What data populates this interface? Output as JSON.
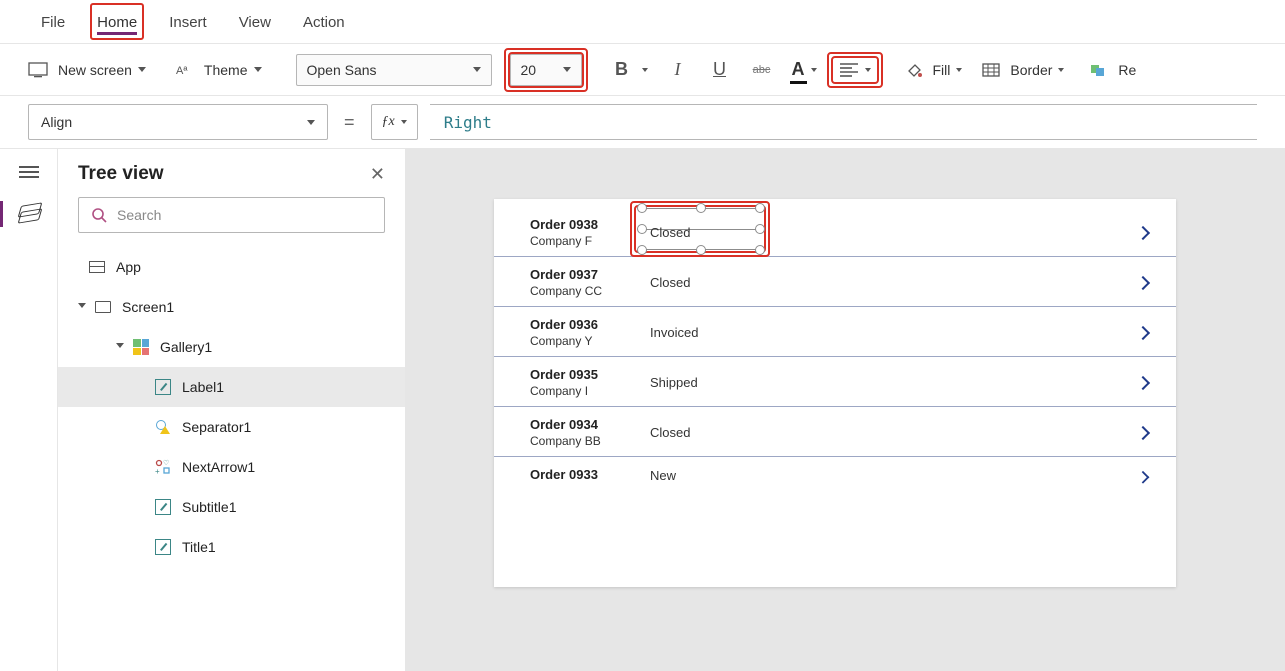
{
  "menu": {
    "tabs": [
      "File",
      "Home",
      "Insert",
      "View",
      "Action"
    ],
    "activeIndex": 1
  },
  "ribbon": {
    "newScreen": "New screen",
    "theme": "Theme",
    "fontName": "Open Sans",
    "fontSize": "20",
    "bold": "B",
    "italic": "I",
    "underline": "U",
    "strike": "abc",
    "fontColorLabel": "A",
    "fill": "Fill",
    "border": "Border",
    "reorder": "Re"
  },
  "propertyBar": {
    "property": "Align",
    "formula": "Right"
  },
  "treeView": {
    "title": "Tree view",
    "searchPlaceholder": "Search",
    "items": {
      "app": "App",
      "screen": "Screen1",
      "gallery": "Gallery1",
      "label": "Label1",
      "separator": "Separator1",
      "nextArrow": "NextArrow1",
      "subtitle": "Subtitle1",
      "title": "Title1"
    }
  },
  "preview": {
    "orders": [
      {
        "title": "Order 0938",
        "subtitle": "Company F",
        "status": "Closed"
      },
      {
        "title": "Order 0937",
        "subtitle": "Company CC",
        "status": "Closed"
      },
      {
        "title": "Order 0936",
        "subtitle": "Company Y",
        "status": "Invoiced"
      },
      {
        "title": "Order 0935",
        "subtitle": "Company I",
        "status": "Shipped"
      },
      {
        "title": "Order 0934",
        "subtitle": "Company BB",
        "status": "Closed"
      },
      {
        "title": "Order 0933",
        "subtitle": "",
        "status": "New"
      }
    ]
  },
  "highlights": {
    "homeTab": true,
    "fontSize": true,
    "align": true,
    "firstStatus": true
  }
}
